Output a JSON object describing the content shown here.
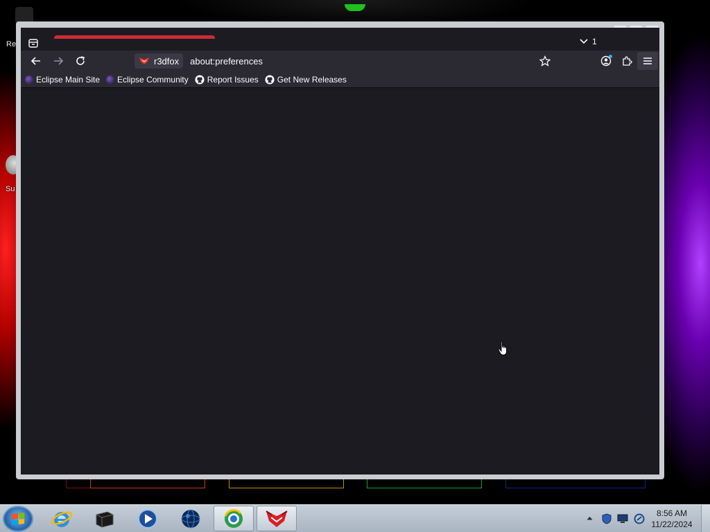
{
  "desktop": {
    "icon_labels": [
      "Re",
      "Su"
    ]
  },
  "browser": {
    "tab_count": "1",
    "url": "about:preferences",
    "identity_label": "r3dfox",
    "bookmarks": [
      {
        "label": "Eclipse Main Site",
        "icon": "eclipse-icon"
      },
      {
        "label": "Eclipse Community",
        "icon": "eclipse-icon"
      },
      {
        "label": "Report Issues",
        "icon": "github-icon"
      },
      {
        "label": "Get New Releases",
        "icon": "github-icon"
      }
    ],
    "accent_color": "#cf2a35"
  },
  "taskbar": {
    "pinned": [
      {
        "name": "internet-explorer",
        "icon": "ie-icon"
      },
      {
        "name": "black-box",
        "icon": "box-app-icon"
      },
      {
        "name": "media-player",
        "icon": "media-player-icon"
      },
      {
        "name": "globe",
        "icon": "globe-icon"
      },
      {
        "name": "browser-circle",
        "icon": "browser-circle-icon"
      },
      {
        "name": "r3dfox",
        "icon": "r3dfox-icon"
      }
    ],
    "clock": {
      "time": "8:56 AM",
      "date": "11/22/2024"
    }
  }
}
